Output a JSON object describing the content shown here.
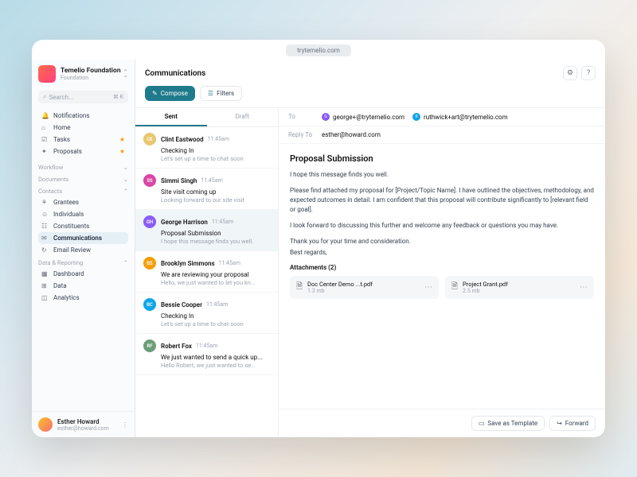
{
  "url": "trytemelio.com",
  "org": {
    "name": "Temelio Foundation",
    "role": "Foundation"
  },
  "search": {
    "placeholder": "Search...",
    "kbd": "⌘ K"
  },
  "nav": {
    "top": [
      {
        "icon": "🔔",
        "label": "Notifications"
      },
      {
        "icon": "⌂",
        "label": "Home"
      },
      {
        "icon": "☑",
        "label": "Tasks",
        "star": true
      },
      {
        "icon": "✦",
        "label": "Proposals",
        "star": true
      }
    ],
    "sections": [
      {
        "label": "Workflow"
      },
      {
        "label": "Documents"
      },
      {
        "label": "Contacts",
        "items": [
          {
            "icon": "⚘",
            "label": "Grantees"
          },
          {
            "icon": "☺",
            "label": "Individuals"
          },
          {
            "icon": "☷",
            "label": "Constituents"
          },
          {
            "icon": "✉",
            "label": "Communications",
            "active": true
          },
          {
            "icon": "↻",
            "label": "Email Review"
          }
        ]
      },
      {
        "label": "Data & Reporting",
        "items": [
          {
            "icon": "▦",
            "label": "Dashboard"
          },
          {
            "icon": "⊞",
            "label": "Data"
          },
          {
            "icon": "◫",
            "label": "Analytics"
          }
        ]
      }
    ]
  },
  "user": {
    "name": "Esther Howard",
    "email": "esther@howard.com"
  },
  "page": {
    "title": "Communications",
    "compose": "Compose",
    "filters": "Filters",
    "tabs": [
      "Sent",
      "Draft"
    ],
    "messages": [
      {
        "initials": "CE",
        "color": "#e8c770",
        "name": "Clint Eastwood",
        "time": "11:45am",
        "subject": "Checking In",
        "preview": "Let's set up a time to chat soon"
      },
      {
        "initials": "SS",
        "color": "#d946a6",
        "name": "Simmi Singh",
        "time": "11:45am",
        "subject": "Site visit coming up",
        "preview": "Looking forward to our site visit"
      },
      {
        "initials": "GH",
        "color": "#8b5cf6",
        "name": "George Harrison",
        "time": "11:45am",
        "subject": "Proposal Submission",
        "preview": "I hope this message finds you well.",
        "selected": true
      },
      {
        "initials": "BS",
        "color": "#f59e0b",
        "name": "Brooklyn Simmons",
        "time": "11:45am",
        "subject": "We are reviewing your proposal",
        "preview": "Hello, we just wanted to let you kn..."
      },
      {
        "initials": "BC",
        "color": "#0ea5e9",
        "name": "Bessie Cooper",
        "time": "11:45am",
        "subject": "Checking In",
        "preview": "Let's set up a time to chat soon"
      },
      {
        "initials": "RF",
        "color": "#6b9e78",
        "name": "Robert Fox",
        "time": "11:45am",
        "subject": "We just wanted to send a quick up...",
        "preview": "Hello Robert, we just wanted to se..."
      }
    ],
    "detail": {
      "toLabel": "To",
      "to": [
        {
          "initial": "G",
          "color": "#8b5cf6",
          "email": "george+@trytemelio.com"
        },
        {
          "initial": "R",
          "color": "#0ea5e9",
          "email": "ruthwick+art@trytemelio.com"
        }
      ],
      "replyLabel": "Reply To",
      "replyTo": "esther@howard.com",
      "subject": "Proposal Submission",
      "p1": "I hope this message finds you well.",
      "p2": "Please find attached my proposal for [Project/Topic Name]. I have outlined the objectives, methodology, and expected outcomes in detail. I am confident that this proposal will contribute significantly to [relevant field or goal].",
      "p3": "I look forward to discussing this further and welcome any feedback or questions you may have.",
      "p4": "Thank you for your time and consideration.",
      "p5": "Best regards,",
      "attLabel": "Attachments (2)",
      "attachments": [
        {
          "name": "Doc Center Demo ...t.pdf",
          "size": "1.3 mb"
        },
        {
          "name": "Project Grant.pdf",
          "size": "2.5 mb"
        }
      ],
      "saveTemplate": "Save as Template",
      "forward": "Forward"
    }
  }
}
